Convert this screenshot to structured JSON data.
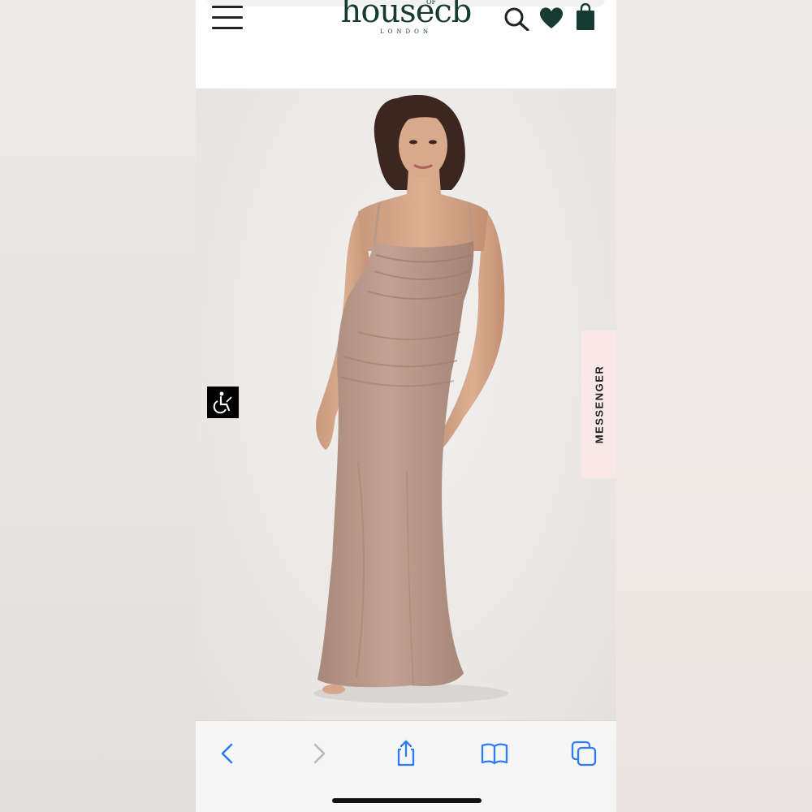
{
  "browser": {
    "site": {
      "logo_text": "house",
      "logo_text_b": "cb",
      "logo_of": "OF",
      "logo_sub": "LONDON"
    },
    "header_icons": [
      "menu-icon",
      "search-icon",
      "heart-icon",
      "shopping-bag-icon"
    ],
    "hero": {
      "product_color_hex": "#b9998a",
      "messenger_label": "MESSENGER",
      "accessibility_icon": "accessibility-icon"
    },
    "toolbar": {
      "buttons": [
        "back-icon",
        "forward-icon",
        "share-icon",
        "bookmarks-icon",
        "tabs-icon"
      ],
      "accent_color": "#2f7cf6"
    }
  }
}
